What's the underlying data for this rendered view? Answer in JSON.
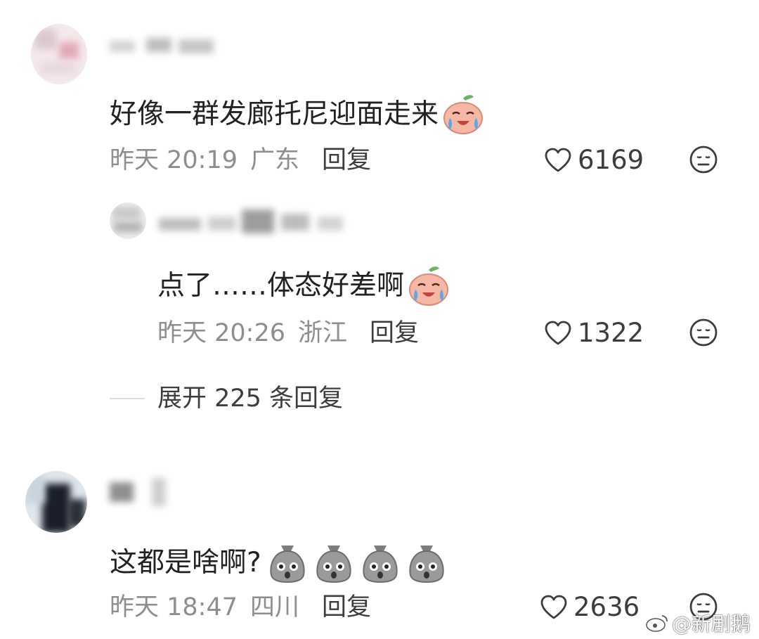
{
  "comments": [
    {
      "text": "好像一群发廊托尼迎面走来",
      "emojis": [
        "crying-peach-emoji"
      ],
      "time": "昨天 20:19",
      "location": "广东",
      "reply_label": "回复",
      "likes": "6169",
      "replies": [
        {
          "text": "点了……体态好差啊",
          "emojis": [
            "crying-peach-emoji"
          ],
          "time": "昨天 20:26",
          "location": "浙江",
          "reply_label": "回复",
          "likes": "1322"
        }
      ],
      "expand_label": "展开 225 条回复"
    },
    {
      "text": "这都是啥啊?",
      "emojis": [
        "shocked-bag-emoji",
        "shocked-bag-emoji",
        "shocked-bag-emoji",
        "shocked-bag-emoji"
      ],
      "time": "昨天 18:47",
      "location": "四川",
      "reply_label": "回复",
      "likes": "2636"
    }
  ],
  "watermark": "@新剧鹅",
  "colors": {
    "meta": "#8e8e8e",
    "text": "#222222",
    "peach": "#f4a08f"
  }
}
